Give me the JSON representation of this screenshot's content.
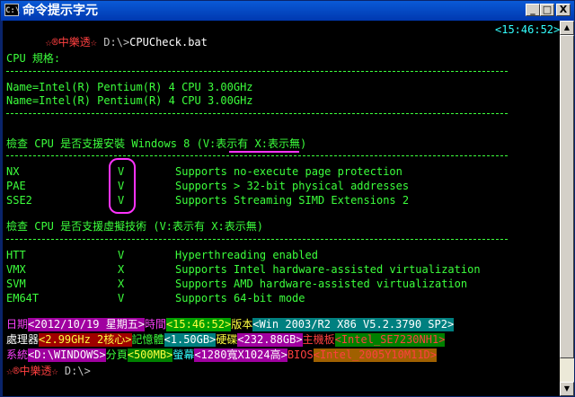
{
  "window": {
    "icon_text": "C:\\",
    "title": "命令提示字元",
    "minimize": "_",
    "maximize": "□",
    "close": "X"
  },
  "prompt": {
    "brand": "☆®中樂透☆",
    "path": " D:\\>",
    "command": "CPUCheck.bat",
    "time": "<15:46:52>"
  },
  "cpu_spec": {
    "heading": "CPU 規格:",
    "lines": [
      "Name=Intel(R) Pentium(R) 4 CPU 3.00GHz",
      "Name=Intel(R) Pentium(R) 4 CPU 3.00GHz"
    ]
  },
  "install_check": {
    "heading_pre": "檢查 CPU 是否支援安裝 Windows 8 ",
    "heading_legend": "(V:表示有",
    "heading_post": " X:表示無)",
    "rows": [
      {
        "name": "NX",
        "mark": "V",
        "desc": "Supports no-execute page protection"
      },
      {
        "name": "PAE",
        "mark": "V",
        "desc": "Supports > 32-bit physical addresses"
      },
      {
        "name": "SSE2",
        "mark": "V",
        "desc": "Supports Streaming SIMD Extensions 2"
      }
    ]
  },
  "virt_check": {
    "heading": "檢查 CPU 是否支援虛擬技術 (V:表示有 X:表示無)",
    "rows": [
      {
        "name": "HTT",
        "mark": "V",
        "desc": "Hyperthreading enabled"
      },
      {
        "name": "VMX",
        "mark": "X",
        "desc": "Supports Intel hardware-assisted virtualization"
      },
      {
        "name": "SVM",
        "mark": "X",
        "desc": "Supports AMD hardware-assisted virtualization"
      },
      {
        "name": "EM64T",
        "mark": "V",
        "desc": "Supports 64-bit mode"
      }
    ]
  },
  "status": {
    "row1": {
      "date_label": "日期",
      "date_value": "<2012/10/19 星期五>",
      "time_label": "時間",
      "time_value": "<15:46:52>",
      "ver_label": "版本",
      "ver_value": "<Win 2003/R2 X86 V5.2.3790 SP2>"
    },
    "row2": {
      "cpu_label": "處理器",
      "cpu_value": "<2.99GHz 2核心>",
      "mem_label": "記憶體",
      "mem_value": "<1.50GB>",
      "disk_label": "硬碟",
      "disk_value": "<232.88GB>",
      "board_label": "主機板",
      "board_value": "<Intel_SE7230NH1>"
    },
    "row3": {
      "sys_label": "系統",
      "sys_value": "<D:\\WINDOWS>",
      "page_label": "分頁",
      "page_value": "<500MB>",
      "screen_label": "螢幕",
      "screen_value": "<1280寬X1024高>",
      "bios_label": "BIOS",
      "bios_value": "<Intel_2005Y10M11D>"
    }
  },
  "final_prompt": {
    "brand": "☆®中樂透☆",
    "path": " D:\\>"
  },
  "colors": {
    "console_bg": "#000000",
    "title_bar": "#0a5ad6",
    "highlight": "#ff33ff"
  }
}
